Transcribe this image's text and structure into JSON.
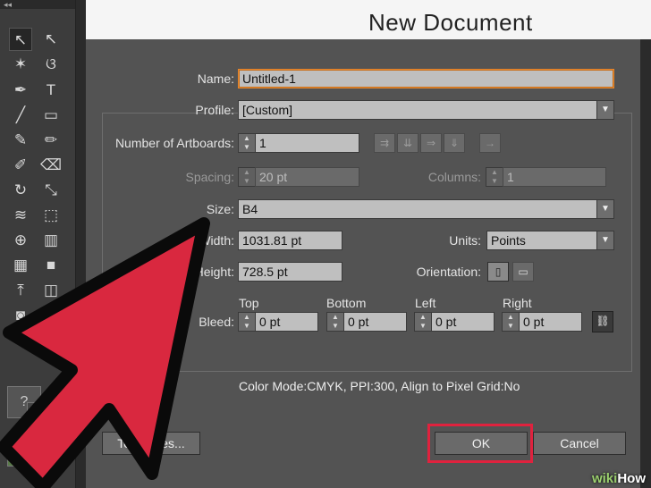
{
  "dialog": {
    "title": "New Document",
    "name_label": "Name:",
    "name_value": "Untitled-1",
    "profile_label": "Profile:",
    "profile_value": "[Custom]",
    "artboards_label": "Number of Artboards:",
    "artboards_value": "1",
    "spacing_label": "Spacing:",
    "spacing_value": "20 pt",
    "columns_label": "Columns:",
    "columns_value": "1",
    "size_label": "Size:",
    "size_value": "B4",
    "width_label": "Width:",
    "width_value": "1031.81 pt",
    "units_label": "Units:",
    "units_value": "Points",
    "height_label": "Height:",
    "height_value": "728.5 pt",
    "orientation_label": "Orientation:",
    "bleed_label": "Bleed:",
    "bleed": {
      "top_label": "Top",
      "top_value": "0 pt",
      "bottom_label": "Bottom",
      "bottom_value": "0 pt",
      "left_label": "Left",
      "left_value": "0 pt",
      "right_label": "Right",
      "right_value": "0 pt"
    },
    "color_mode_text": "Color Mode:CMYK, PPI:300, Align to Pixel Grid:No",
    "templates_label": "Templates...",
    "ok_label": "OK",
    "cancel_label": "Cancel"
  },
  "toolbar": {
    "collapse_glyph": "◂◂",
    "question_glyph": "?"
  },
  "watermark": {
    "wiki": "wiki",
    "how": "How"
  },
  "colors": {
    "highlight": "#e0223e",
    "arrow_fill": "#d9283f",
    "field_focus": "#e8882e"
  }
}
